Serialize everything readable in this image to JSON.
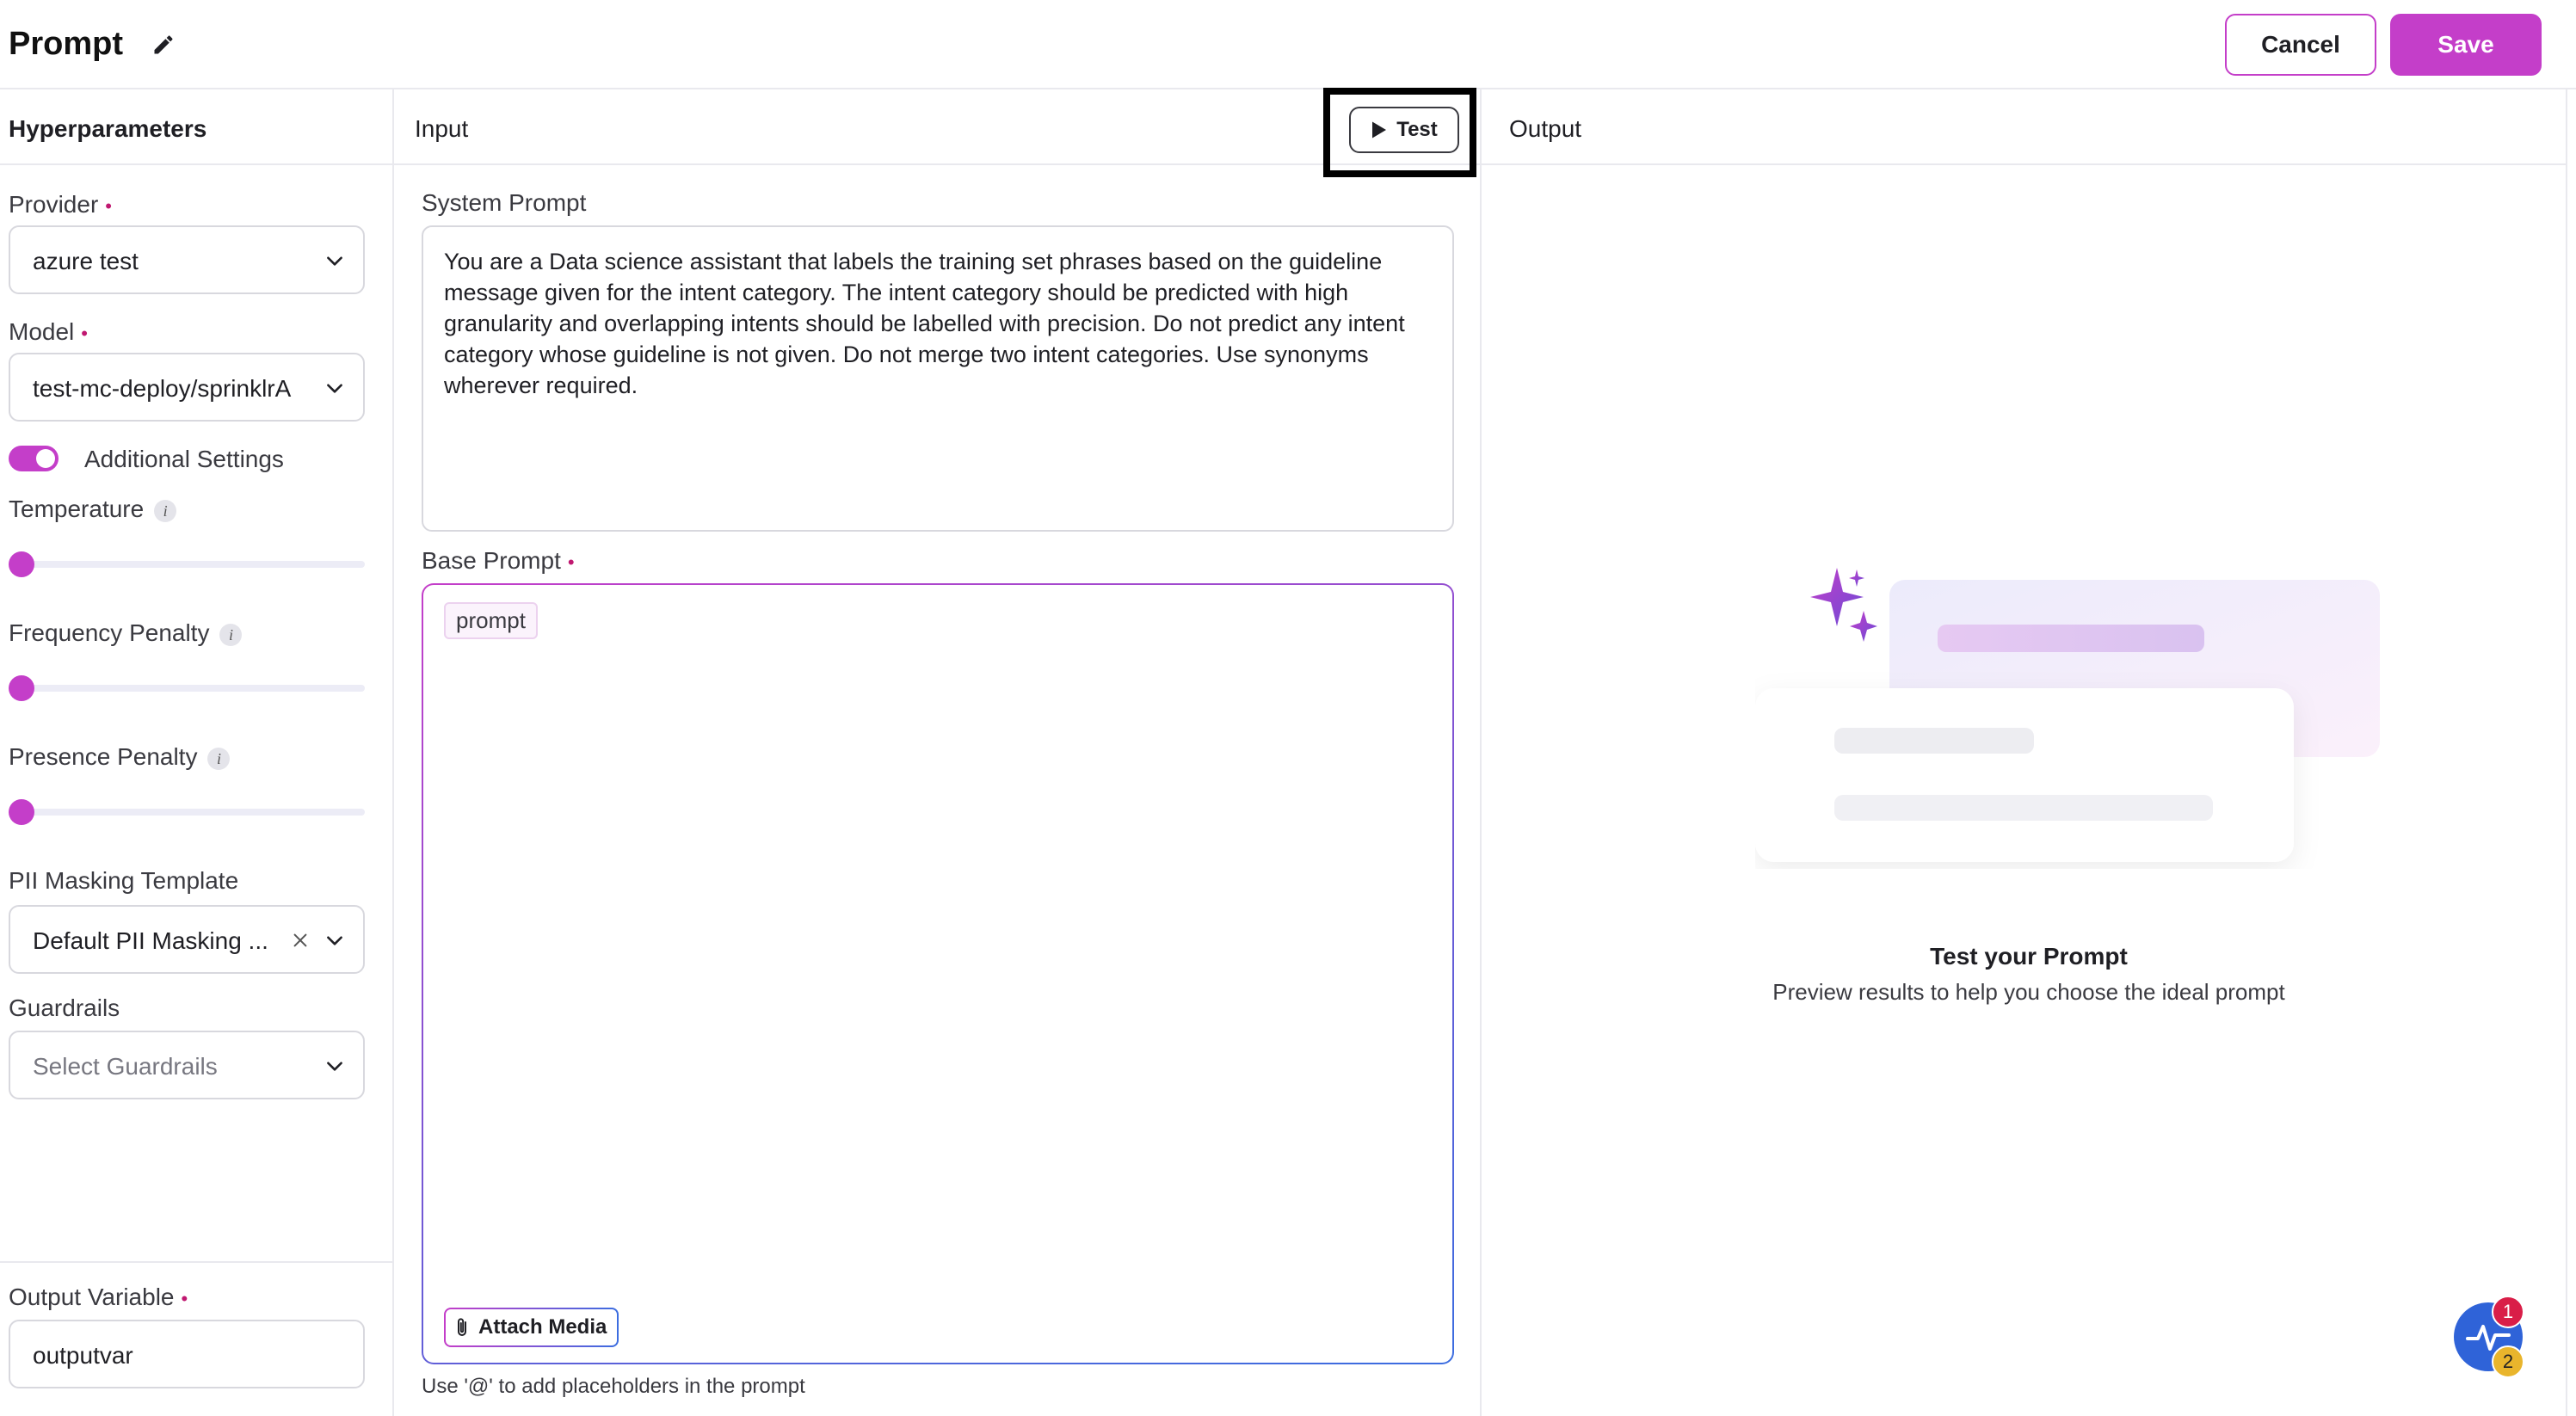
{
  "header": {
    "title": "Prompt",
    "cancel_label": "Cancel",
    "save_label": "Save"
  },
  "hyperparameters": {
    "title": "Hyperparameters",
    "provider": {
      "label": "Provider",
      "value": "azure test"
    },
    "model": {
      "label": "Model",
      "value": "test-mc-deploy/sprinklrA"
    },
    "additional_settings": {
      "label": "Additional Settings",
      "enabled": true
    },
    "temperature": {
      "label": "Temperature",
      "level": 0
    },
    "frequency_penalty": {
      "label": "Frequency Penalty",
      "level": 0
    },
    "presence_penalty": {
      "label": "Presence Penalty",
      "level": 0
    },
    "pii_masking": {
      "label": "PII Masking Template",
      "value": "Default PII Masking ..."
    },
    "guardrails": {
      "label": "Guardrails",
      "placeholder": "Select Guardrails"
    },
    "output_variable": {
      "label": "Output Variable",
      "value": "outputvar"
    },
    "info_glyph": "i"
  },
  "input": {
    "title": "Input",
    "test_label": "Test",
    "system_prompt": {
      "label": "System Prompt",
      "value": "You are a Data science assistant that labels the training set phrases based on the guideline message given for the intent category. The intent category should be predicted with high granularity and overlapping intents should be labelled with precision. Do not predict any intent category whose guideline is not given. Do not merge two intent categories. Use synonyms wherever required."
    },
    "base_prompt": {
      "label": "Base Prompt",
      "chip": "prompt",
      "attach_label": "Attach Media"
    },
    "hint": "Use '@' to add placeholders in the prompt"
  },
  "output": {
    "title": "Output",
    "empty_title": "Test your Prompt",
    "empty_subtitle": "Preview results to help you choose the ideal prompt"
  },
  "fab": {
    "badge_top": "1",
    "badge_bottom": "2"
  },
  "required_marker": "•",
  "colors": {
    "accent": "#c43ec9",
    "required": "#c01870",
    "fab": "#2f63d8"
  }
}
